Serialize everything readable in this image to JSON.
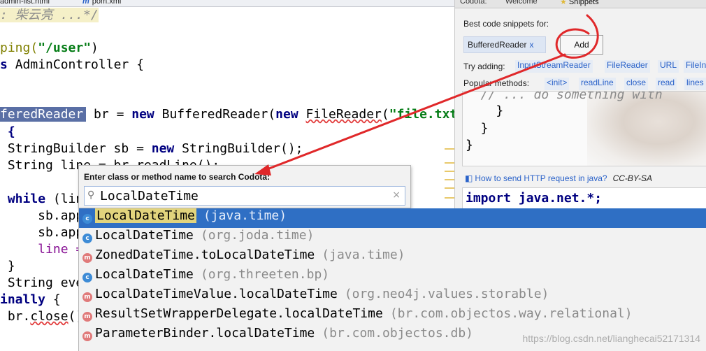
{
  "editor": {
    "tabs": [
      {
        "label": "admin-list.html"
      },
      {
        "label": "pom.xml"
      }
    ],
    "lines": {
      "l1": ": 柴云亮 ...*/",
      "l2a": "ping(",
      "l2b": "\"/user\"",
      "l2c": ")",
      "l3a": "s ",
      "l3b": "AdminController {",
      "l4a": "feredReader",
      "l4b": " br = ",
      "l4c": "new",
      "l4d": " BufferedReader(",
      "l4e": "new",
      "l4f": " ",
      "l4g": "FileReader",
      "l4h": "(",
      "l4i": "\"file.txt\"",
      "l5": " {",
      "l6a": " StringBuilder sb = ",
      "l6b": "new",
      "l6c": " StringBuilder();",
      "l7": " String line = br.readLine();",
      "l8a": " ",
      "l8b": "while",
      "l8c": " (line != null",
      "l9": "     sb.app",
      "l10": "     sb.app",
      "l11": "     line =",
      "l12": " }",
      "l13": " String eve",
      "l14a": "inally",
      "l14b": " {",
      "l15a": " br.",
      "l15b": "close",
      "l15c": "()"
    }
  },
  "codota": {
    "tabs": {
      "codota": "Codota:",
      "welcome": "Welcome",
      "snippets": "Snippets"
    },
    "best_label": "Best code snippets for:",
    "chip_label": "BufferedReader",
    "chip_close": "x",
    "add_button": "Add",
    "try_label": "Try adding:",
    "try_items": [
      "InputStreamReader",
      "FileReader",
      "URL",
      "FileIn"
    ],
    "popular_label": "Popular methods:",
    "popular_items": [
      "<init>",
      "readLine",
      "close",
      "read",
      "lines"
    ],
    "snippet1": {
      "l1": "  // ... do something with",
      "l2": "    }",
      "l3": "  }",
      "l4": "}"
    },
    "how_to": "How to send HTTP request in java?",
    "license": "CC-BY-SA",
    "snippet2_code": "import java.net.*;"
  },
  "popup": {
    "title": "Enter class or method name to search Codota:",
    "query": "LocalDateTime",
    "clear": "×"
  },
  "suggestions": [
    {
      "kind": "c",
      "name": "LocalDateTime",
      "pkg": "(java.time)",
      "selected": true
    },
    {
      "kind": "c",
      "name": "LocalDateTime",
      "pkg": "(org.joda.time)"
    },
    {
      "kind": "m",
      "name": "ZonedDateTime.toLocalDateTime",
      "pkg": "(java.time)"
    },
    {
      "kind": "c",
      "name": "LocalDateTime",
      "pkg": "(org.threeten.bp)"
    },
    {
      "kind": "m",
      "name": "LocalDateTimeValue.localDateTime",
      "pkg": "(org.neo4j.values.storable)"
    },
    {
      "kind": "m",
      "name": "ResultSetWrapperDelegate.localDateTime",
      "pkg": "(br.com.objectos.way.relational)"
    },
    {
      "kind": "m",
      "name": "ParameterBinder.localDateTime",
      "pkg": "(br.com.objectos.db)"
    }
  ],
  "watermark": "https://blog.csdn.net/lianghecai52171314",
  "colors": {
    "selection": "#2f6fc4",
    "annotation_red": "#e0282a",
    "link_blue": "#2a62c9"
  }
}
